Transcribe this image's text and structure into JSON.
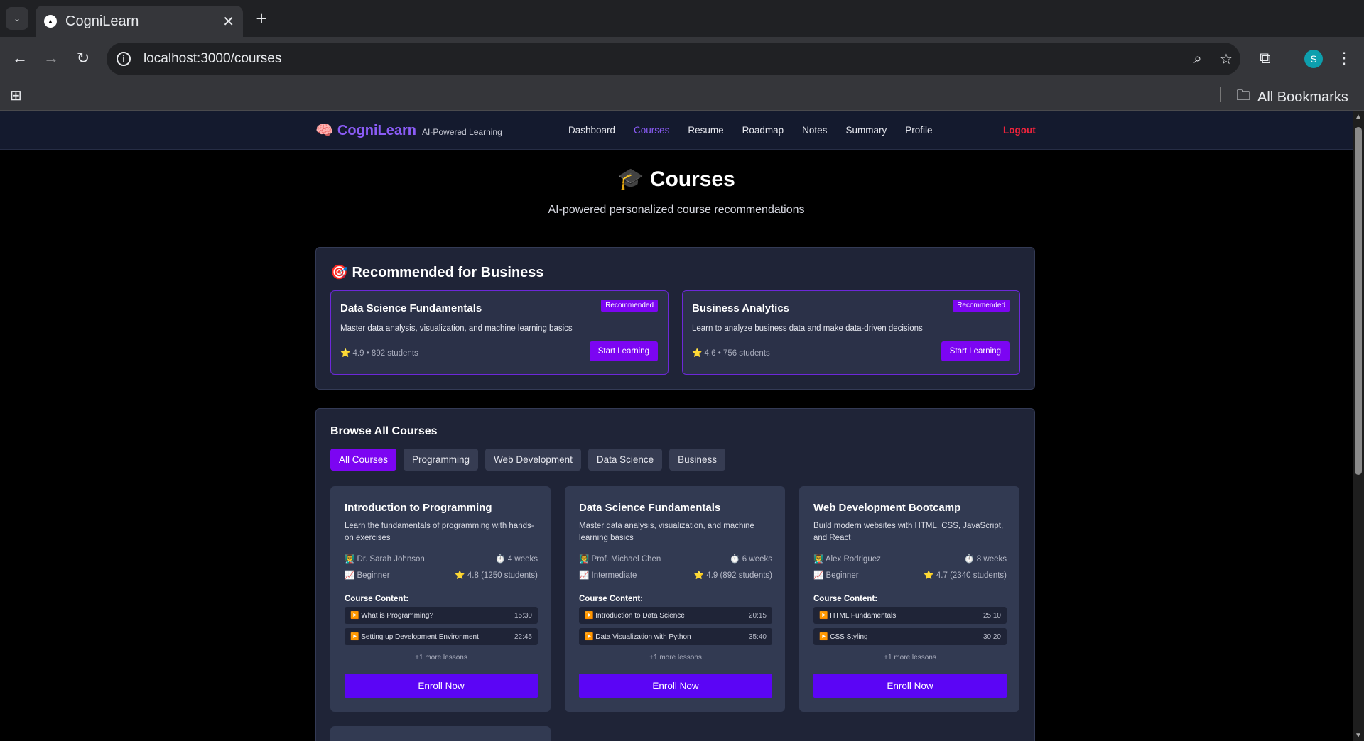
{
  "browser": {
    "tab_title": "CogniLearn",
    "url": "localhost:3000/courses",
    "bookmarks_label": "All Bookmarks",
    "profile_initial": "S"
  },
  "app": {
    "brand_name": "CogniLearn",
    "brand_tagline": "AI-Powered Learning",
    "nav": [
      "Dashboard",
      "Courses",
      "Resume",
      "Roadmap",
      "Notes",
      "Summary",
      "Profile"
    ],
    "active_nav": "Courses",
    "logout": "Logout"
  },
  "page": {
    "title": "🎓 Courses",
    "subtitle": "AI-powered personalized course recommendations"
  },
  "recommended": {
    "heading": "🎯 Recommended for Business",
    "cards": [
      {
        "title": "Data Science Fundamentals",
        "badge": "Recommended",
        "description": "Master data analysis, visualization, and machine learning basics",
        "meta": "⭐ 4.9 • 892 students",
        "button": "Start Learning"
      },
      {
        "title": "Business Analytics",
        "badge": "Recommended",
        "description": "Learn to analyze business data and make data-driven decisions",
        "meta": "⭐ 4.6 • 756 students",
        "button": "Start Learning"
      }
    ]
  },
  "browse": {
    "heading": "Browse All Courses",
    "filters": [
      "All Courses",
      "Programming",
      "Web Development",
      "Data Science",
      "Business"
    ],
    "active_filter": "All Courses",
    "content_label": "Course Content:",
    "courses": [
      {
        "title": "Introduction to Programming",
        "description": "Learn the fundamentals of programming with hands-on exercises",
        "instructor": "👨‍🏫 Dr. Sarah Johnson",
        "duration": "⏱️ 4 weeks",
        "level": "📈 Beginner",
        "rating": "⭐ 4.8 (1250 students)",
        "lessons": [
          {
            "name": "▶️ What is Programming?",
            "duration": "15:30"
          },
          {
            "name": "▶️ Setting up Development Environment",
            "duration": "22:45"
          }
        ],
        "more": "+1 more lessons",
        "button": "Enroll Now"
      },
      {
        "title": "Data Science Fundamentals",
        "description": "Master data analysis, visualization, and machine learning basics",
        "instructor": "👨‍🏫 Prof. Michael Chen",
        "duration": "⏱️ 6 weeks",
        "level": "📈 Intermediate",
        "rating": "⭐ 4.9 (892 students)",
        "lessons": [
          {
            "name": "▶️ Introduction to Data Science",
            "duration": "20:15"
          },
          {
            "name": "▶️ Data Visualization with Python",
            "duration": "35:40"
          }
        ],
        "more": "+1 more lessons",
        "button": "Enroll Now"
      },
      {
        "title": "Web Development Bootcamp",
        "description": "Build modern websites with HTML, CSS, JavaScript, and React",
        "instructor": "👨‍🏫 Alex Rodriguez",
        "duration": "⏱️ 8 weeks",
        "level": "📈 Beginner",
        "rating": "⭐ 4.7 (2340 students)",
        "lessons": [
          {
            "name": "▶️ HTML Fundamentals",
            "duration": "25:10"
          },
          {
            "name": "▶️ CSS Styling",
            "duration": "30:20"
          }
        ],
        "more": "+1 more lessons",
        "button": "Enroll Now"
      }
    ]
  },
  "colors": {
    "accent": "#7c05f2",
    "brand": "#8b5cf6",
    "logout": "#ef233c",
    "panel": "#1f2437"
  }
}
